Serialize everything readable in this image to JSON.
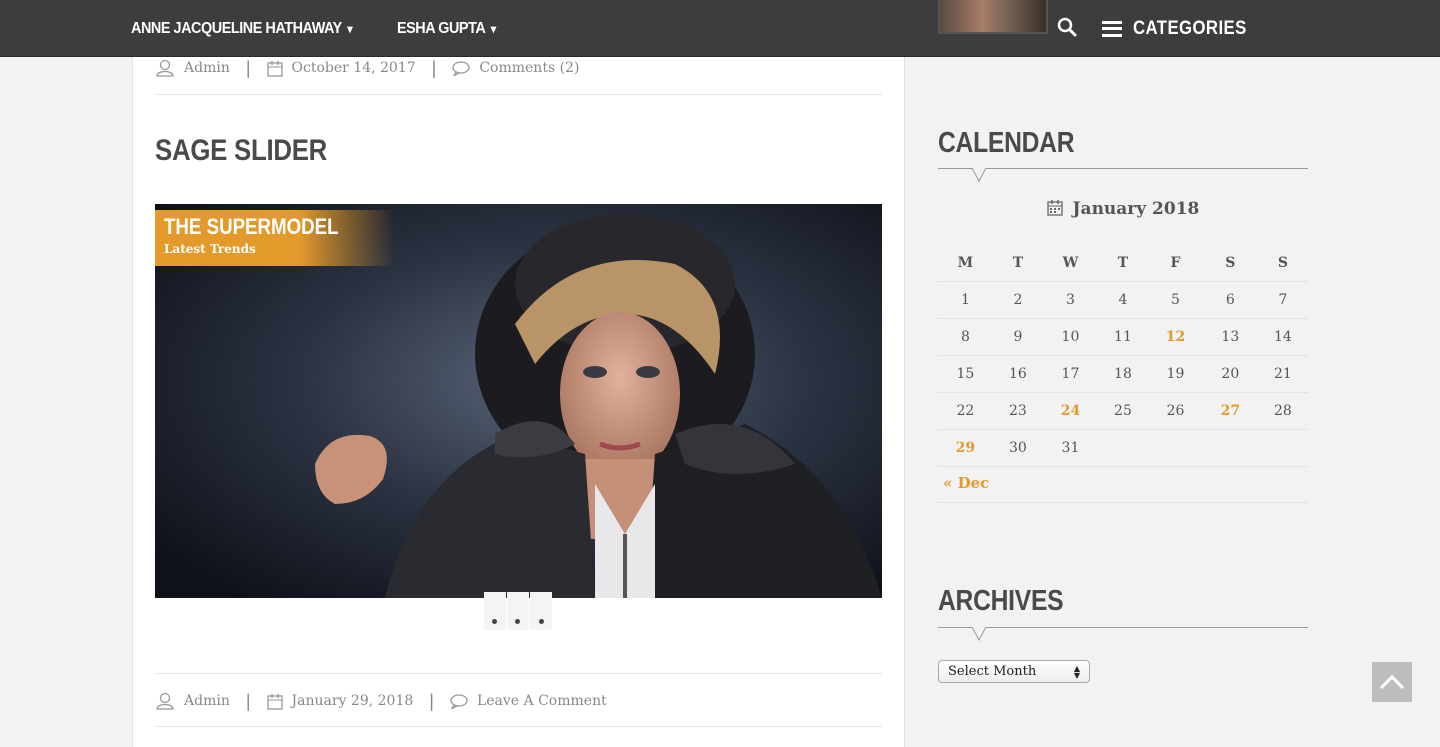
{
  "nav": {
    "items": [
      {
        "label": "ANNE JACQUELINE HATHAWAY",
        "caret": "▾"
      },
      {
        "label": "ESHA GUPTA",
        "caret": "▾"
      }
    ],
    "categories_label": "CATEGORIES"
  },
  "post_prev_meta": {
    "author": "Admin",
    "date": "October 14, 2017",
    "comments": "Comments (2)",
    "separator": "|"
  },
  "post": {
    "title": "SAGE SLIDER",
    "slider": {
      "caption_title": "THE SUPERMODEL",
      "caption_subtitle": "Latest Trends",
      "slide_count": 3
    },
    "meta": {
      "author": "Admin",
      "date": "January 29, 2018",
      "comments": "Leave A Comment"
    }
  },
  "sidebar": {
    "calendar": {
      "title": "CALENDAR",
      "month": "January 2018",
      "weekdays": [
        "M",
        "T",
        "W",
        "T",
        "F",
        "S",
        "S"
      ],
      "weeks": [
        [
          "1",
          "2",
          "3",
          "4",
          "5",
          "6",
          "7"
        ],
        [
          "8",
          "9",
          "10",
          "11",
          "12",
          "13",
          "14"
        ],
        [
          "15",
          "16",
          "17",
          "18",
          "19",
          "20",
          "21"
        ],
        [
          "22",
          "23",
          "24",
          "25",
          "26",
          "27",
          "28"
        ],
        [
          "29",
          "30",
          "31",
          "",
          "",
          "",
          ""
        ]
      ],
      "linked_days": [
        "12",
        "24",
        "27",
        "29"
      ],
      "prev_link": "« Dec"
    },
    "archives": {
      "title": "ARCHIVES",
      "select_value": "Select Month"
    }
  },
  "colors": {
    "accent": "#e49a2b",
    "topbar": "#3d3d3d",
    "heading": "#4a4a4a"
  }
}
